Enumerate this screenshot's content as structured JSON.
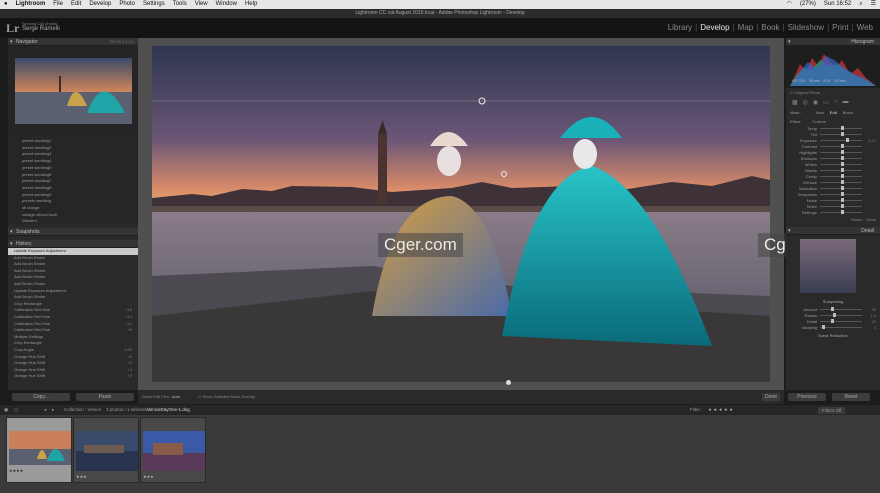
{
  "menubar": {
    "app": "Lightroom",
    "items": [
      "File",
      "Edit",
      "Develop",
      "Photo",
      "Settings",
      "Tools",
      "View",
      "Window",
      "Help"
    ],
    "battery": "(27%)",
    "clock": "Sun 16:52"
  },
  "window_title": "Lightroom CC cat August 2015.lrcat - Adobe Photoshop Lightroom - Develop",
  "identity": {
    "logo": "Lr",
    "catalog": "Syncing 144 photos",
    "user": "Serge Ramelli"
  },
  "modules": [
    "Library",
    "Develop",
    "Map",
    "Book",
    "Slideshow",
    "Print",
    "Web"
  ],
  "active_module": "Develop",
  "left": {
    "navigator_title": "Navigator",
    "navigator_zoom": [
      "Fit",
      "Fill",
      "1:1",
      "3:1"
    ],
    "presets": [
      "preset wedding1",
      "preset wedding2",
      "preset wedding3",
      "preset wedding4",
      "preset wedding5",
      "preset wedding6",
      "preset wedding7",
      "preset wedding8",
      "preset wedding9",
      "presets wedding",
      "sfl orange",
      "vintage chouxl book",
      "Western"
    ],
    "snapshots_title": "Snapshots",
    "history_title": "History",
    "history": [
      {
        "label": "Update Exposure Adjustment",
        "val": ""
      },
      {
        "label": "Add Brush Stroke",
        "val": ""
      },
      {
        "label": "Add Brush Stroke",
        "val": ""
      },
      {
        "label": "Add Brush Stroke",
        "val": ""
      },
      {
        "label": "Add Brush Stroke",
        "val": ""
      },
      {
        "label": "Add Brush Stroke",
        "val": ""
      },
      {
        "label": "Update Exposure Adjustment",
        "val": ""
      },
      {
        "label": "Add Brush Stroke",
        "val": ""
      },
      {
        "label": "Crop Rectangle",
        "val": ""
      },
      {
        "label": "Calibration Red Hue",
        "val": "+18"
      },
      {
        "label": "Calibration Red Hue",
        "val": "+14"
      },
      {
        "label": "Calibration Red Hue",
        "val": "+10"
      },
      {
        "label": "Calibration Red Hue",
        "val": "+6"
      },
      {
        "label": "Multiple Settings",
        "val": ""
      },
      {
        "label": "Crop Rectangle",
        "val": ""
      },
      {
        "label": "Crop Angle",
        "val": "0.63"
      },
      {
        "label": "Orange Hue Shift",
        "val": "+8"
      },
      {
        "label": "Orange Hue Shift",
        "val": "+6"
      },
      {
        "label": "Orange Hue Shift",
        "val": "+4"
      },
      {
        "label": "Orange Hue Shift",
        "val": "+2"
      }
    ],
    "copy_btn": "Copy...",
    "paste_btn": "Paste"
  },
  "toolbar": {
    "show_edit_pins": "Show Edit Pins :",
    "pins_value": "Auto",
    "show_mask": "Show Selected Mask Overlay",
    "done": "Done"
  },
  "right": {
    "histogram_title": "Histogram",
    "histogram_info": [
      "ISO 100",
      "35 mm",
      "f/2.8",
      "1/3 sec"
    ],
    "original_photo": "Original Photo",
    "mask_label": "Mask :",
    "mask_new": "New",
    "mask_edit": "Edit",
    "mask_brush": "Brush",
    "effect_label": "Effect :",
    "effect_value": "Custom",
    "sliders": [
      {
        "label": "Temp",
        "pos": 0.5,
        "val": ""
      },
      {
        "label": "Tint",
        "pos": 0.5,
        "val": ""
      },
      {
        "label": "Exposure",
        "pos": 0.62,
        "val": "0.24"
      },
      {
        "label": "Contrast",
        "pos": 0.5,
        "val": ""
      },
      {
        "label": "Highlights",
        "pos": 0.5,
        "val": ""
      },
      {
        "label": "Shadows",
        "pos": 0.5,
        "val": ""
      },
      {
        "label": "Whites",
        "pos": 0.5,
        "val": ""
      },
      {
        "label": "Blacks",
        "pos": 0.5,
        "val": ""
      },
      {
        "label": "Clarity",
        "pos": 0.5,
        "val": ""
      },
      {
        "label": "Dehaze",
        "pos": 0.5,
        "val": ""
      },
      {
        "label": "Saturation",
        "pos": 0.5,
        "val": ""
      },
      {
        "label": "Sharpness",
        "pos": 0.5,
        "val": ""
      },
      {
        "label": "Noise",
        "pos": 0.5,
        "val": ""
      },
      {
        "label": "Moiré",
        "pos": 0.5,
        "val": ""
      },
      {
        "label": "Defringe",
        "pos": 0.5,
        "val": ""
      }
    ],
    "brush_reset": "Reset",
    "brush_close": "Close",
    "detail_title": "Detail",
    "sharpening_title": "Sharpening",
    "sharpening": [
      {
        "label": "Amount",
        "pos": 0.25,
        "val": "25"
      },
      {
        "label": "Radius",
        "pos": 0.3,
        "val": "1.0"
      },
      {
        "label": "Detail",
        "pos": 0.25,
        "val": "25"
      },
      {
        "label": "Masking",
        "pos": 0.05,
        "val": "0"
      }
    ],
    "noise_title": "Noise Reduction",
    "previous_btn": "Previous",
    "reset_btn": "Reset"
  },
  "filmstrip": {
    "collection": "Collection : Venice",
    "count": "3 photos / 1 selected /",
    "filename": "VeniceDayOne-1.dng",
    "filter_label": "Filter :",
    "filter_value": "Filters Off",
    "thumbs": [
      {
        "stars": "★★★★",
        "selected": true
      },
      {
        "stars": "★★★",
        "selected": false
      },
      {
        "stars": "★★★",
        "selected": false
      }
    ]
  },
  "watermark": "Cger.com"
}
